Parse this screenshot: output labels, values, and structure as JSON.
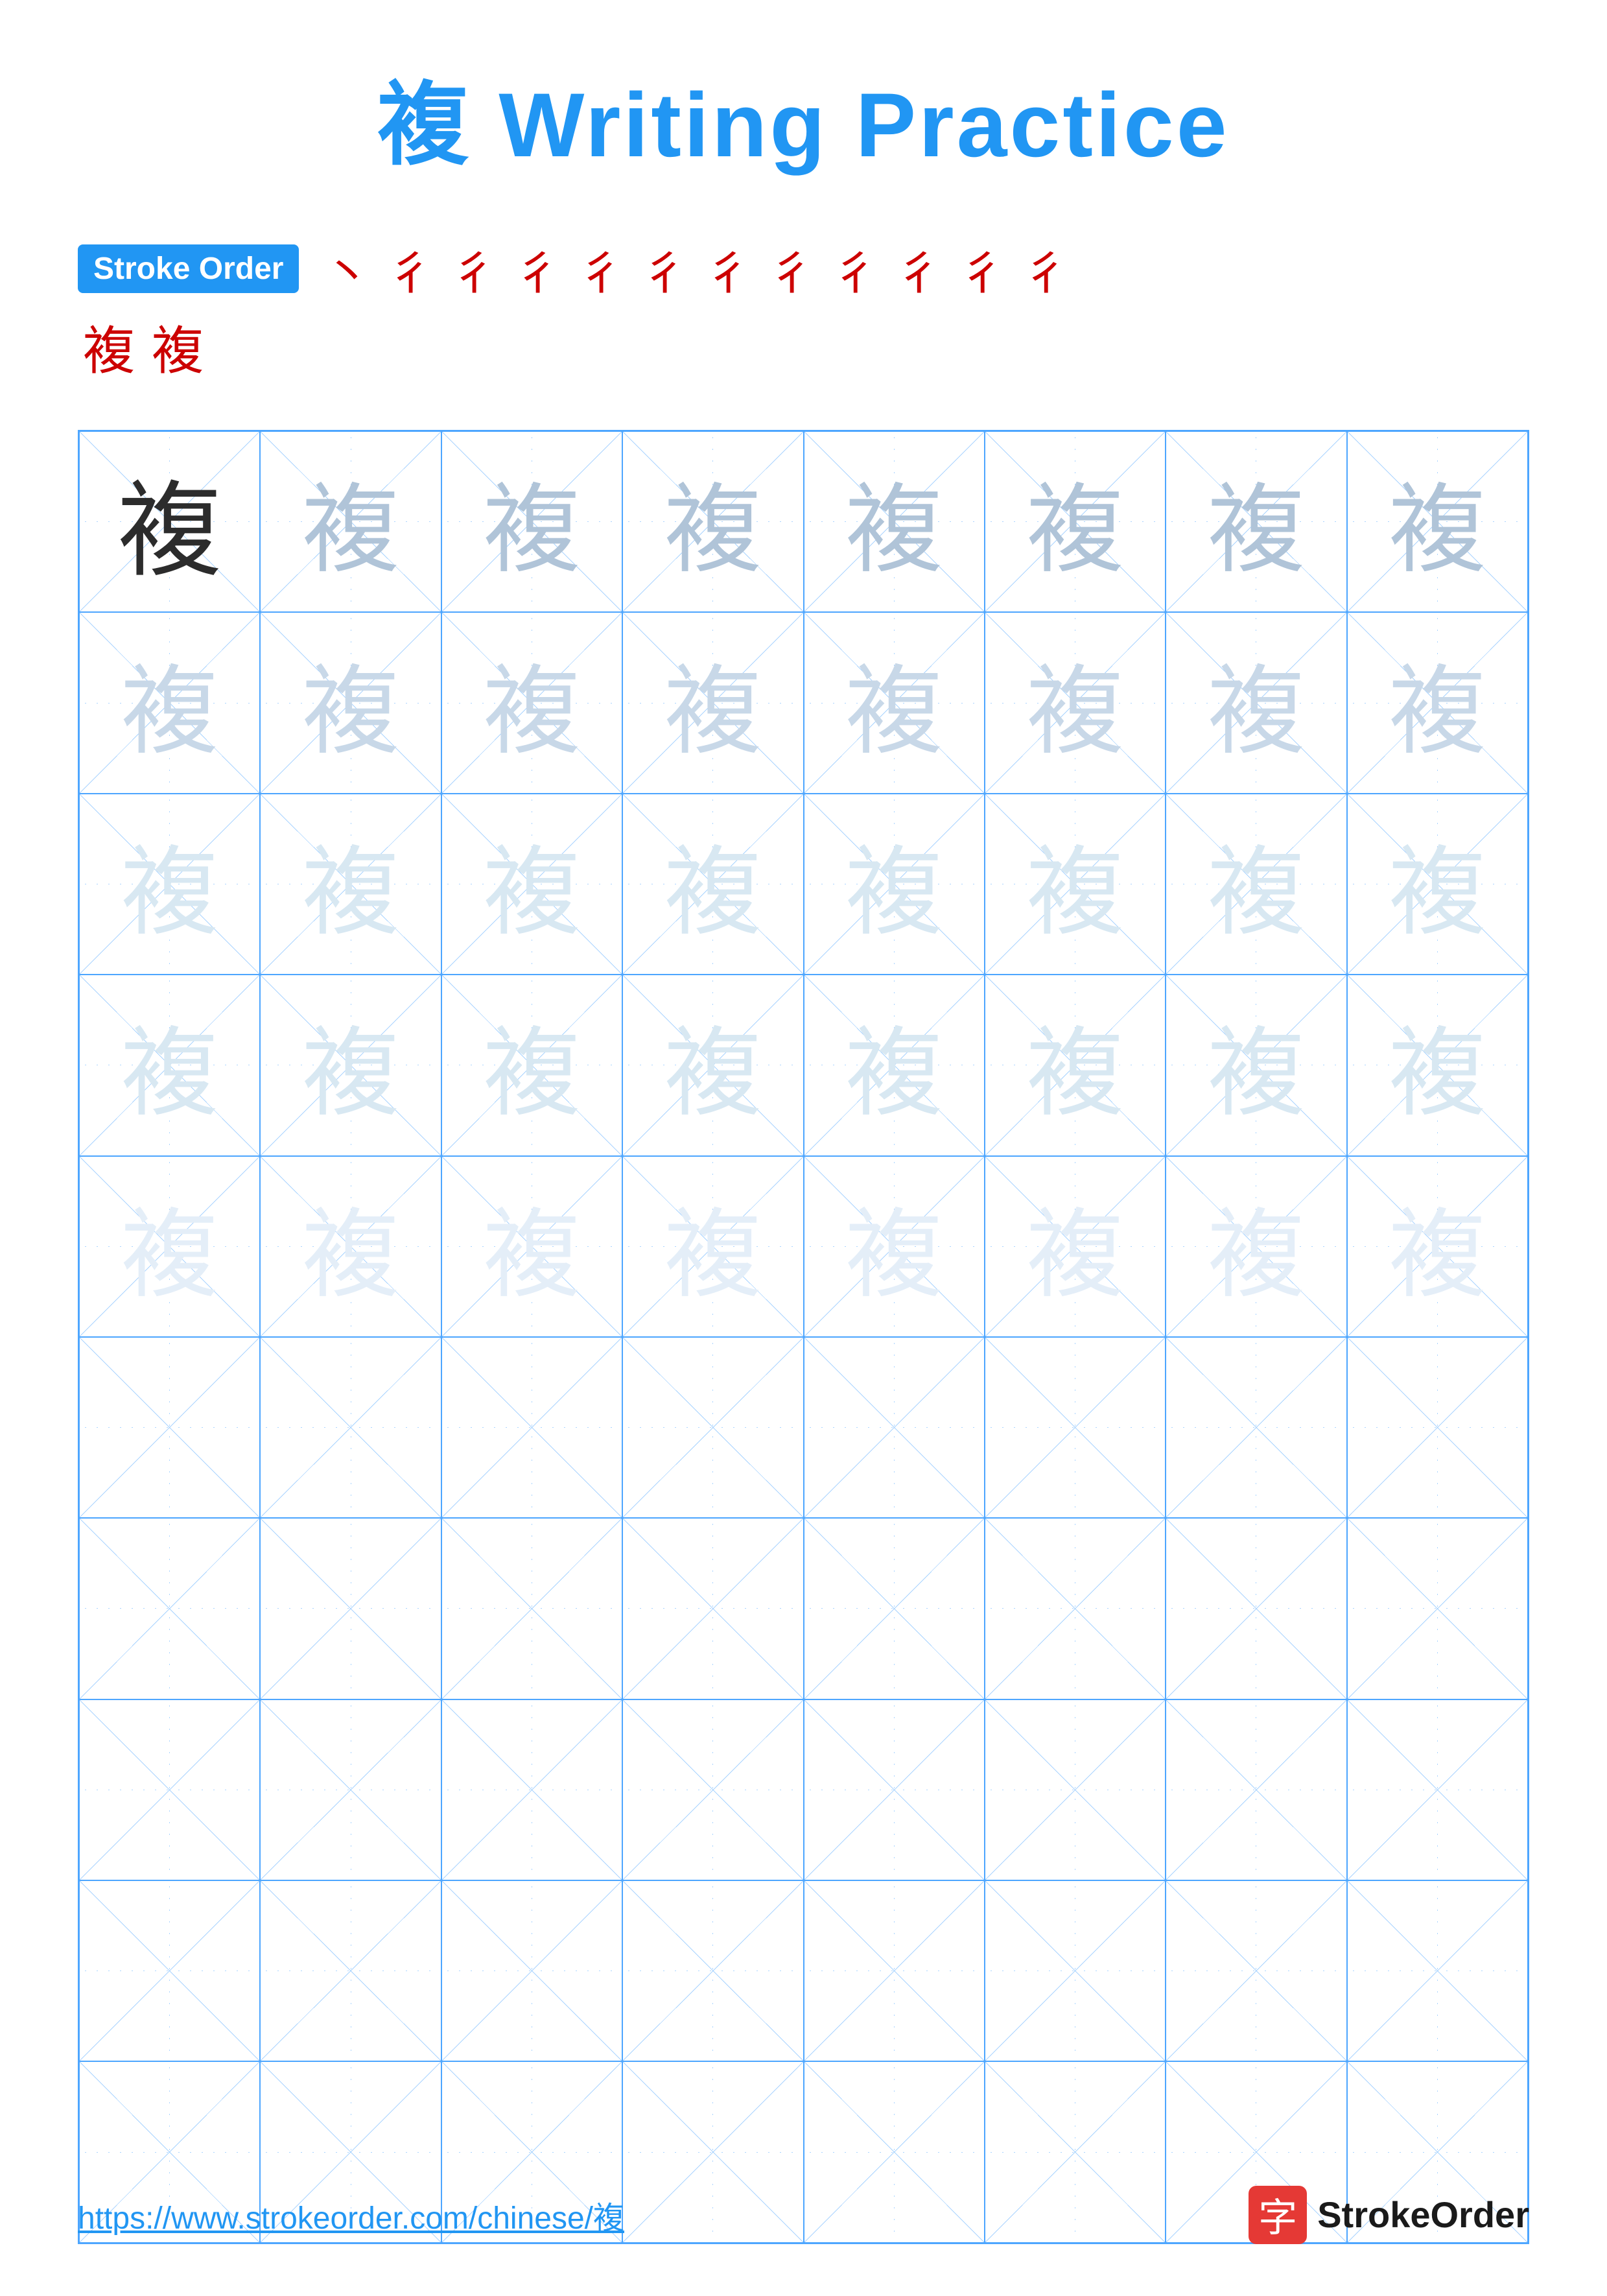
{
  "title": "複 Writing Practice",
  "stroke_order_label": "Stroke Order",
  "stroke_chars": [
    "丶",
    "彳",
    "彳",
    "彳",
    "彳",
    "彳",
    "彳",
    "彳",
    "彳",
    "彳",
    "彳",
    "彳",
    "複",
    "複"
  ],
  "character": "複",
  "grid": {
    "rows": 10,
    "cols": 8,
    "filled_rows": 5,
    "char": "複"
  },
  "footer": {
    "url": "https://www.strokeorder.com/chinese/複",
    "logo_char": "字",
    "logo_text": "StrokeOrder"
  }
}
